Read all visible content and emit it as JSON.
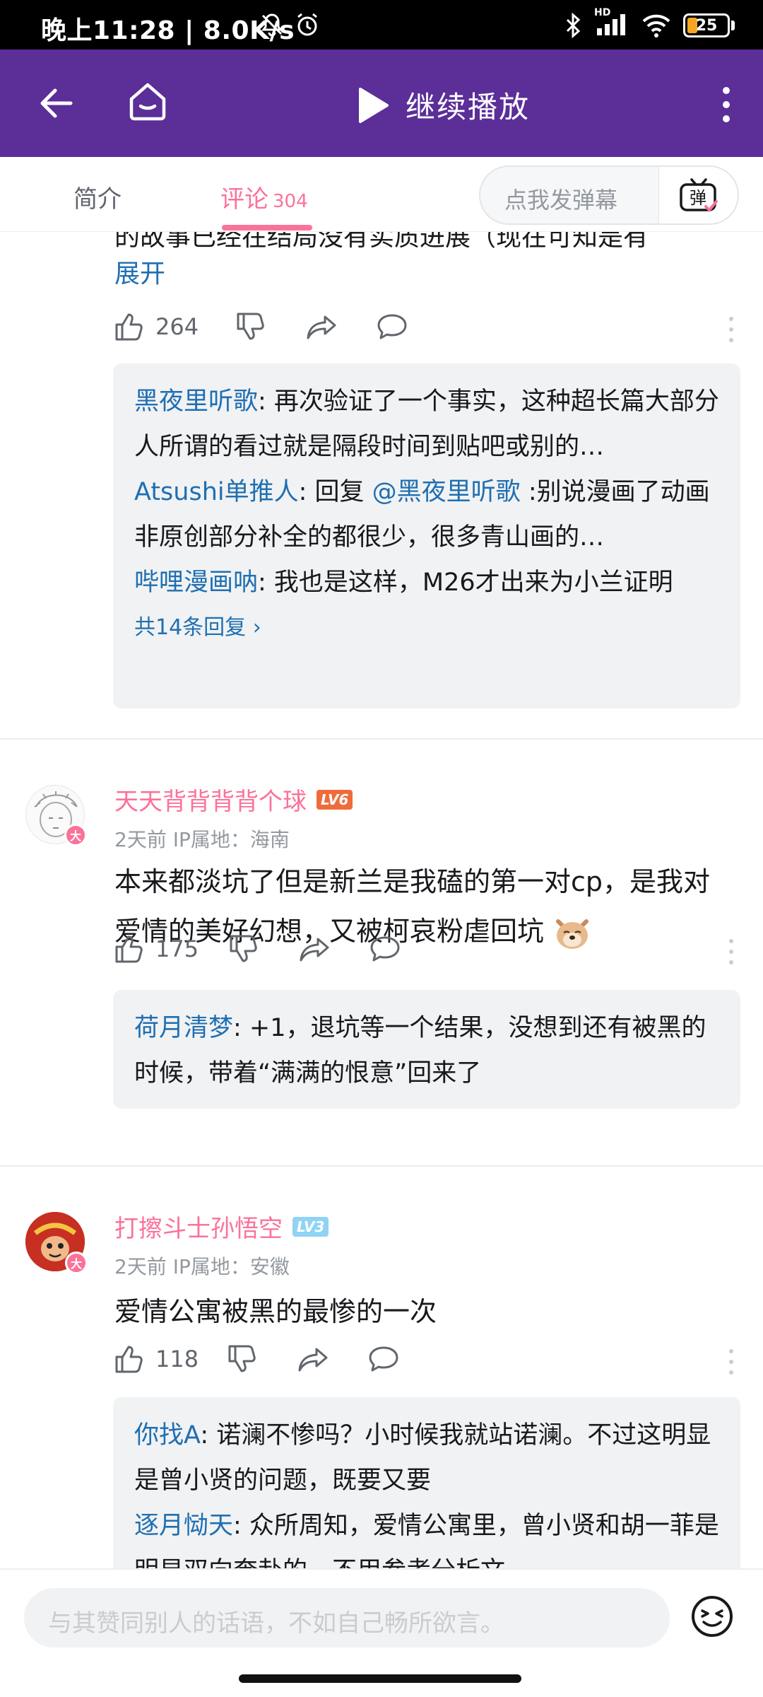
{
  "status_bar": {
    "time_speed": "晚上11:28 | 8.0K/s",
    "battery": "25",
    "signal_label": "HD"
  },
  "nav": {
    "continue_play": "继续播放"
  },
  "tabs": {
    "intro": "简介",
    "comments": "评论",
    "comments_count": "304",
    "danmaku_placeholder": "点我发弹幕",
    "danmaku_button": "弹"
  },
  "thread1": {
    "partial_text": "的故事已经在结局没有实质进展（现在可知是有",
    "expand": "展开",
    "likes": "264",
    "replies": [
      {
        "user": "黑夜里听歌",
        "text": ": 再次验证了一个事实，这种超长篇大部分人所谓的看过就是隔段时间到贴吧或别的…"
      },
      {
        "user": "Atsushi单推人",
        "text": ": 回复 ",
        "mention": "@黑夜里听歌",
        "text2": " :别说漫画了动画非原创部分补全的都很少，很多青山画的…"
      },
      {
        "user": "哔哩漫画呐",
        "text": ": 我也是这样，M26才出来为小兰证明"
      }
    ],
    "total_replies": "共14条回复 ›"
  },
  "comment2": {
    "username": "天天背背背背个球",
    "level": "LV6",
    "avatar_badge": "大",
    "meta": "2天前  IP属地：海南",
    "text": "本来都淡坑了但是新兰是我磕的第一对cp，是我对爱情的美好幻想，又被柯哀粉虐回坑",
    "likes": "175",
    "replies": [
      {
        "user": "荷月清梦",
        "text": ": +1，退坑等一个结果，没想到还有被黑的时候，带着“满满的恨意”回来了"
      }
    ]
  },
  "comment3": {
    "username": "打擦斗士孙悟空",
    "level": "LV3",
    "avatar_badge": "大",
    "meta": "2天前  IP属地：安徽",
    "text": "爱情公寓被黑的最惨的一次",
    "likes": "118",
    "replies": [
      {
        "user": "你找A",
        "text": ": 诺澜不惨吗？小时候我就站诺澜。不过这明显是曾小贤的问题，既要又要"
      },
      {
        "user": "逐月恸天",
        "text": ": 众所周知，爱情公寓里，曾小贤和胡一菲是明显双向奔赴的，不用参考分析文"
      }
    ]
  },
  "bottom": {
    "input_placeholder": "与其赞同别人的话语，不如自己畅所欲言。"
  },
  "colors": {
    "nav_purple": "#5b2e98",
    "pink": "#fb7299",
    "link_blue": "#1f6fb2"
  }
}
